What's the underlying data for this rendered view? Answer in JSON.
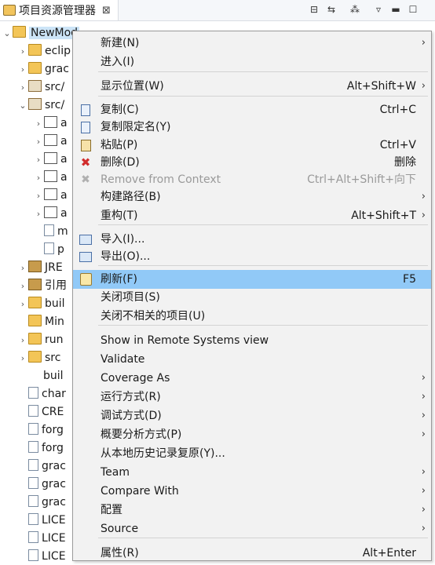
{
  "view": {
    "title": "项目资源管理器",
    "close": "⊠",
    "toolbar_icons": [
      "collapse-all-icon",
      "link-with-editor-icon",
      "filter-icon",
      "view-menu-icon",
      "minimize-icon",
      "maximize-icon"
    ]
  },
  "tree": {
    "project": "NewMod",
    "items": [
      {
        "label": "eclip",
        "twisty": "›"
      },
      {
        "label": "grac",
        "twisty": "›"
      },
      {
        "label": "src/",
        "twisty": "›"
      },
      {
        "label": "src/",
        "twisty": "⌄"
      },
      {
        "label": "a",
        "twisty": "›"
      },
      {
        "label": "a",
        "twisty": "›"
      },
      {
        "label": "a",
        "twisty": "›"
      },
      {
        "label": "a",
        "twisty": "›"
      },
      {
        "label": "a",
        "twisty": "›"
      },
      {
        "label": "a",
        "twisty": "›"
      },
      {
        "label": "m",
        "twisty": ""
      },
      {
        "label": "p",
        "twisty": ""
      },
      {
        "label": "JRE",
        "twisty": "›"
      },
      {
        "label": "引用",
        "twisty": "›"
      },
      {
        "label": "buil",
        "twisty": "›"
      },
      {
        "label": "Min",
        "twisty": ""
      },
      {
        "label": "run",
        "twisty": "›"
      },
      {
        "label": "src",
        "twisty": "›"
      },
      {
        "label": "buil",
        "twisty": ""
      },
      {
        "label": "char",
        "twisty": ""
      },
      {
        "label": "CRE",
        "twisty": ""
      },
      {
        "label": "forg",
        "twisty": ""
      },
      {
        "label": "forg",
        "twisty": ""
      },
      {
        "label": "grac",
        "twisty": ""
      },
      {
        "label": "grac",
        "twisty": ""
      },
      {
        "label": "grac",
        "twisty": ""
      },
      {
        "label": "LICE",
        "twisty": ""
      },
      {
        "label": "LICE",
        "twisty": ""
      },
      {
        "label": "LICE",
        "twisty": ""
      }
    ]
  },
  "menu": {
    "items": [
      {
        "label": "新建(N)",
        "shortcut": "",
        "arrow": "›"
      },
      {
        "label": "进入(I)",
        "shortcut": "",
        "arrow": ""
      },
      {
        "label": "显示位置(W)",
        "shortcut": "Alt+Shift+W",
        "arrow": "›"
      },
      {
        "label": "复制(C)",
        "shortcut": "Ctrl+C",
        "arrow": ""
      },
      {
        "label": "复制限定名(Y)",
        "shortcut": "",
        "arrow": ""
      },
      {
        "label": "粘贴(P)",
        "shortcut": "Ctrl+V",
        "arrow": ""
      },
      {
        "label": "删除(D)",
        "shortcut": "删除",
        "arrow": ""
      },
      {
        "label": "Remove from Context",
        "shortcut": "Ctrl+Alt+Shift+向下",
        "arrow": ""
      },
      {
        "label": "构建路径(B)",
        "shortcut": "",
        "arrow": "›"
      },
      {
        "label": "重构(T)",
        "shortcut": "Alt+Shift+T",
        "arrow": "›"
      },
      {
        "label": "导入(I)...",
        "shortcut": "",
        "arrow": ""
      },
      {
        "label": "导出(O)...",
        "shortcut": "",
        "arrow": ""
      },
      {
        "label": "刷新(F)",
        "shortcut": "F5",
        "arrow": ""
      },
      {
        "label": "关闭项目(S)",
        "shortcut": "",
        "arrow": ""
      },
      {
        "label": "关闭不相关的项目(U)",
        "shortcut": "",
        "arrow": ""
      },
      {
        "label": "Show in Remote Systems view",
        "shortcut": "",
        "arrow": ""
      },
      {
        "label": "Validate",
        "shortcut": "",
        "arrow": ""
      },
      {
        "label": "Coverage As",
        "shortcut": "",
        "arrow": "›"
      },
      {
        "label": "运行方式(R)",
        "shortcut": "",
        "arrow": "›"
      },
      {
        "label": "调试方式(D)",
        "shortcut": "",
        "arrow": "›"
      },
      {
        "label": "概要分析方式(P)",
        "shortcut": "",
        "arrow": "›"
      },
      {
        "label": "从本地历史记录复原(Y)...",
        "shortcut": "",
        "arrow": ""
      },
      {
        "label": "Team",
        "shortcut": "",
        "arrow": "›"
      },
      {
        "label": "Compare With",
        "shortcut": "",
        "arrow": "›"
      },
      {
        "label": "配置",
        "shortcut": "",
        "arrow": "›"
      },
      {
        "label": "Source",
        "shortcut": "",
        "arrow": "›"
      },
      {
        "label": "属性(R)",
        "shortcut": "Alt+Enter",
        "arrow": ""
      }
    ]
  },
  "colors": {
    "highlight": "#91c9f7",
    "menu_bg": "#f2f2f2",
    "disabled": "#9a9a9a"
  }
}
